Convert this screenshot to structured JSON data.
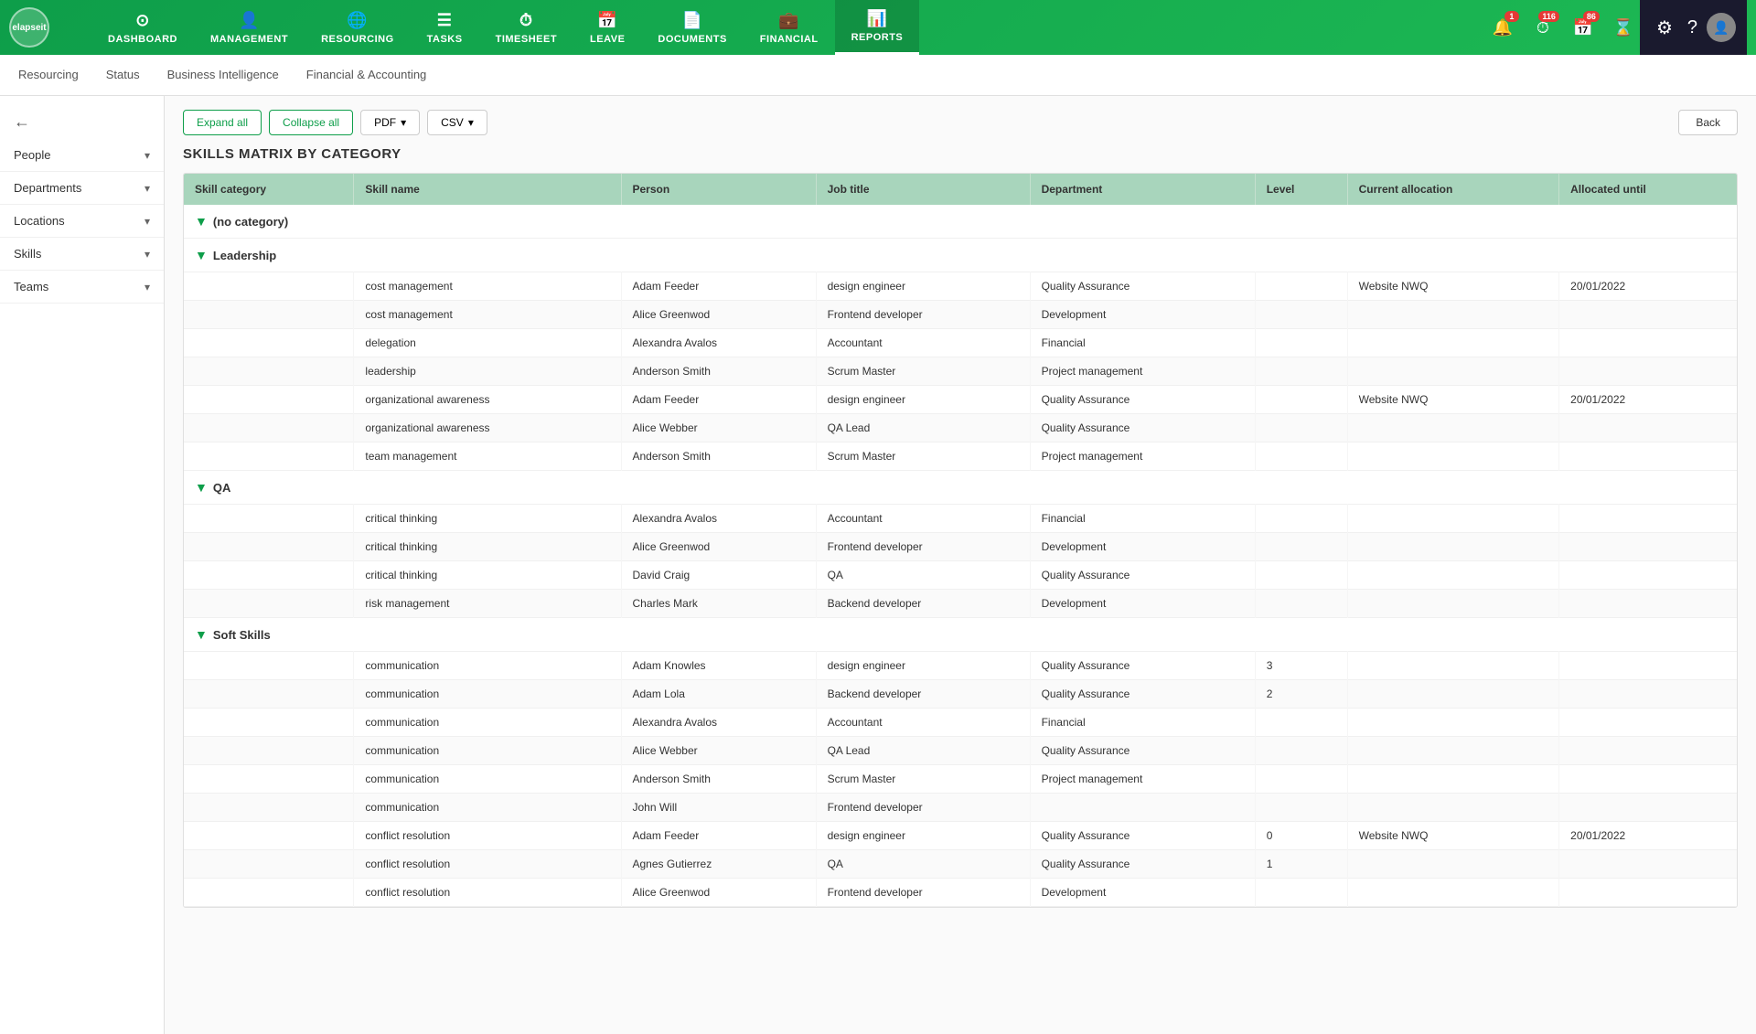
{
  "app": {
    "name": "elapseit"
  },
  "nav": {
    "items": [
      {
        "id": "dashboard",
        "label": "DASHBOARD",
        "icon": "⊙"
      },
      {
        "id": "management",
        "label": "MANAGEMENT",
        "icon": "👤"
      },
      {
        "id": "resourcing",
        "label": "RESOURCING",
        "icon": "🌐"
      },
      {
        "id": "tasks",
        "label": "TASKS",
        "icon": "☰"
      },
      {
        "id": "timesheet",
        "label": "TIMESHEET",
        "icon": "⏱"
      },
      {
        "id": "leave",
        "label": "LEAVE",
        "icon": "📅"
      },
      {
        "id": "documents",
        "label": "DOCUMENTS",
        "icon": "📄"
      },
      {
        "id": "financial",
        "label": "FINANCIAL",
        "icon": "💼"
      },
      {
        "id": "reports",
        "label": "REPORTS",
        "icon": "📊",
        "active": true
      }
    ],
    "badges": [
      {
        "id": "notifications",
        "icon": "🔔",
        "count": "1",
        "color": "#e53935"
      },
      {
        "id": "timer",
        "icon": "⏱",
        "count": "116",
        "color": "#e53935"
      },
      {
        "id": "calendar",
        "icon": "📅",
        "count": "86",
        "color": "#e53935"
      },
      {
        "id": "hourglass",
        "icon": "⌛",
        "count": "",
        "color": ""
      }
    ]
  },
  "subnav": {
    "items": [
      {
        "id": "resourcing",
        "label": "Resourcing"
      },
      {
        "id": "status",
        "label": "Status"
      },
      {
        "id": "business-intelligence",
        "label": "Business Intelligence"
      },
      {
        "id": "financial-accounting",
        "label": "Financial & Accounting"
      }
    ]
  },
  "sidebar": {
    "back_icon": "←",
    "filters": [
      {
        "id": "people",
        "label": "People"
      },
      {
        "id": "departments",
        "label": "Departments"
      },
      {
        "id": "locations",
        "label": "Locations"
      },
      {
        "id": "skills",
        "label": "Skills"
      },
      {
        "id": "teams",
        "label": "Teams"
      }
    ]
  },
  "toolbar": {
    "expand_all": "Expand all",
    "collapse_all": "Collapse all",
    "pdf": "PDF",
    "csv": "CSV",
    "back": "Back"
  },
  "page_title": "SKILLS MATRIX BY CATEGORY",
  "table": {
    "headers": [
      "Skill category",
      "Skill name",
      "Person",
      "Job title",
      "Department",
      "Level",
      "Current allocation",
      "Allocated until"
    ],
    "sections": [
      {
        "category": "(no category)",
        "rows": []
      },
      {
        "category": "Leadership",
        "rows": [
          {
            "skill_name": "cost management",
            "person": "Adam Feeder",
            "job_title": "design engineer",
            "department": "Quality Assurance",
            "level": "",
            "current_allocation": "Website NWQ",
            "allocated_until": "20/01/2022"
          },
          {
            "skill_name": "cost management",
            "person": "Alice Greenwod",
            "job_title": "Frontend developer",
            "department": "Development",
            "level": "",
            "current_allocation": "",
            "allocated_until": ""
          },
          {
            "skill_name": "delegation",
            "person": "Alexandra Avalos",
            "job_title": "Accountant",
            "department": "Financial",
            "level": "",
            "current_allocation": "",
            "allocated_until": ""
          },
          {
            "skill_name": "leadership",
            "person": "Anderson Smith",
            "job_title": "Scrum Master",
            "department": "Project management",
            "level": "",
            "current_allocation": "",
            "allocated_until": ""
          },
          {
            "skill_name": "organizational awareness",
            "person": "Adam Feeder",
            "job_title": "design engineer",
            "department": "Quality Assurance",
            "level": "",
            "current_allocation": "Website NWQ",
            "allocated_until": "20/01/2022"
          },
          {
            "skill_name": "organizational awareness",
            "person": "Alice Webber",
            "job_title": "QA Lead",
            "department": "Quality Assurance",
            "level": "",
            "current_allocation": "",
            "allocated_until": ""
          },
          {
            "skill_name": "team management",
            "person": "Anderson Smith",
            "job_title": "Scrum Master",
            "department": "Project management",
            "level": "",
            "current_allocation": "",
            "allocated_until": ""
          }
        ]
      },
      {
        "category": "QA",
        "rows": [
          {
            "skill_name": "critical thinking",
            "person": "Alexandra Avalos",
            "job_title": "Accountant",
            "department": "Financial",
            "level": "",
            "current_allocation": "",
            "allocated_until": ""
          },
          {
            "skill_name": "critical thinking",
            "person": "Alice Greenwod",
            "job_title": "Frontend developer",
            "department": "Development",
            "level": "",
            "current_allocation": "",
            "allocated_until": ""
          },
          {
            "skill_name": "critical thinking",
            "person": "David Craig",
            "job_title": "QA",
            "department": "Quality Assurance",
            "level": "",
            "current_allocation": "",
            "allocated_until": ""
          },
          {
            "skill_name": "risk management",
            "person": "Charles Mark",
            "job_title": "Backend developer",
            "department": "Development",
            "level": "",
            "current_allocation": "",
            "allocated_until": ""
          }
        ]
      },
      {
        "category": "Soft Skills",
        "rows": [
          {
            "skill_name": "communication",
            "person": "Adam Knowles",
            "job_title": "design engineer",
            "department": "Quality Assurance",
            "level": "3",
            "current_allocation": "",
            "allocated_until": ""
          },
          {
            "skill_name": "communication",
            "person": "Adam Lola",
            "job_title": "Backend developer",
            "department": "Quality Assurance",
            "level": "2",
            "current_allocation": "",
            "allocated_until": ""
          },
          {
            "skill_name": "communication",
            "person": "Alexandra Avalos",
            "job_title": "Accountant",
            "department": "Financial",
            "level": "",
            "current_allocation": "",
            "allocated_until": ""
          },
          {
            "skill_name": "communication",
            "person": "Alice Webber",
            "job_title": "QA Lead",
            "department": "Quality Assurance",
            "level": "",
            "current_allocation": "",
            "allocated_until": ""
          },
          {
            "skill_name": "communication",
            "person": "Anderson Smith",
            "job_title": "Scrum Master",
            "department": "Project management",
            "level": "",
            "current_allocation": "",
            "allocated_until": ""
          },
          {
            "skill_name": "communication",
            "person": "John Will",
            "job_title": "Frontend developer",
            "department": "",
            "level": "",
            "current_allocation": "",
            "allocated_until": ""
          },
          {
            "skill_name": "conflict resolution",
            "person": "Adam Feeder",
            "job_title": "design engineer",
            "department": "Quality Assurance",
            "level": "0",
            "current_allocation": "Website NWQ",
            "allocated_until": "20/01/2022"
          },
          {
            "skill_name": "conflict resolution",
            "person": "Agnes Gutierrez",
            "job_title": "QA",
            "department": "Quality Assurance",
            "level": "1",
            "current_allocation": "",
            "allocated_until": ""
          },
          {
            "skill_name": "conflict resolution",
            "person": "Alice Greenwod",
            "job_title": "Frontend developer",
            "department": "Development",
            "level": "",
            "current_allocation": "",
            "allocated_until": ""
          }
        ]
      }
    ]
  }
}
